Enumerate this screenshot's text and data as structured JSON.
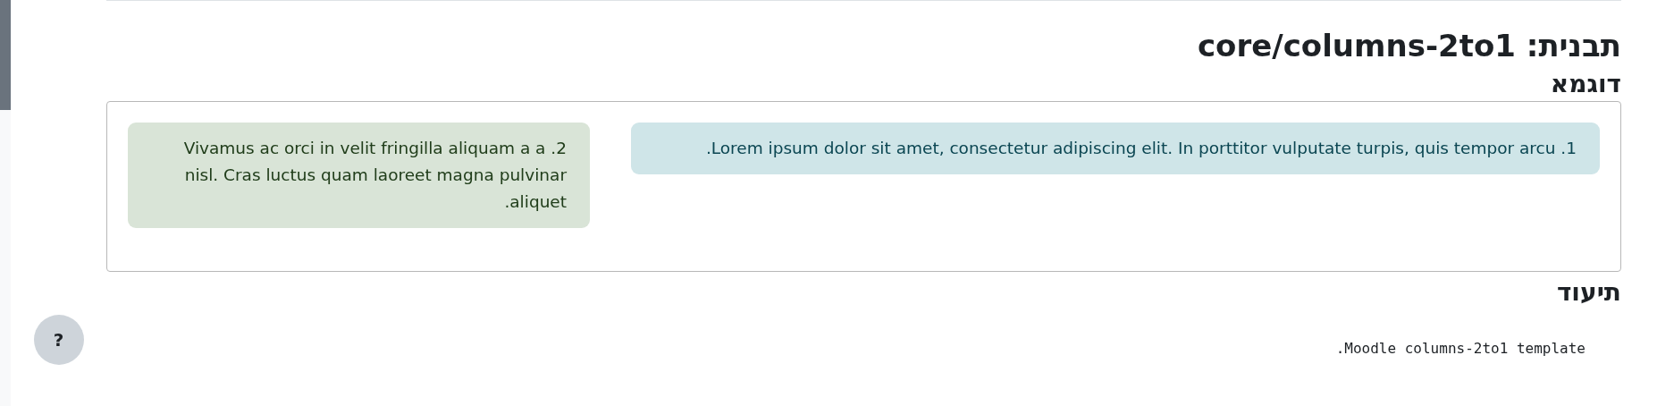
{
  "page": {
    "title": "תבנית: core/columns-2to1"
  },
  "example": {
    "heading": "דוגמא",
    "columns": [
      {
        "text": "1. Lorem ipsum dolor sit amet, consectetur adipiscing elit. In porttitor vulputate turpis, quis tempor arcu.",
        "color": "#cfe5e8"
      },
      {
        "text": "2. Vivamus ac orci in velit fringilla aliquam a a nisl. Cras luctus quam laoreet magna pulvinar aliquet.",
        "color": "#d9e4d7"
      }
    ]
  },
  "documentation": {
    "heading": "תיעוד",
    "code": "Moodle columns-2to1 template."
  },
  "help_button": {
    "label": "?"
  }
}
